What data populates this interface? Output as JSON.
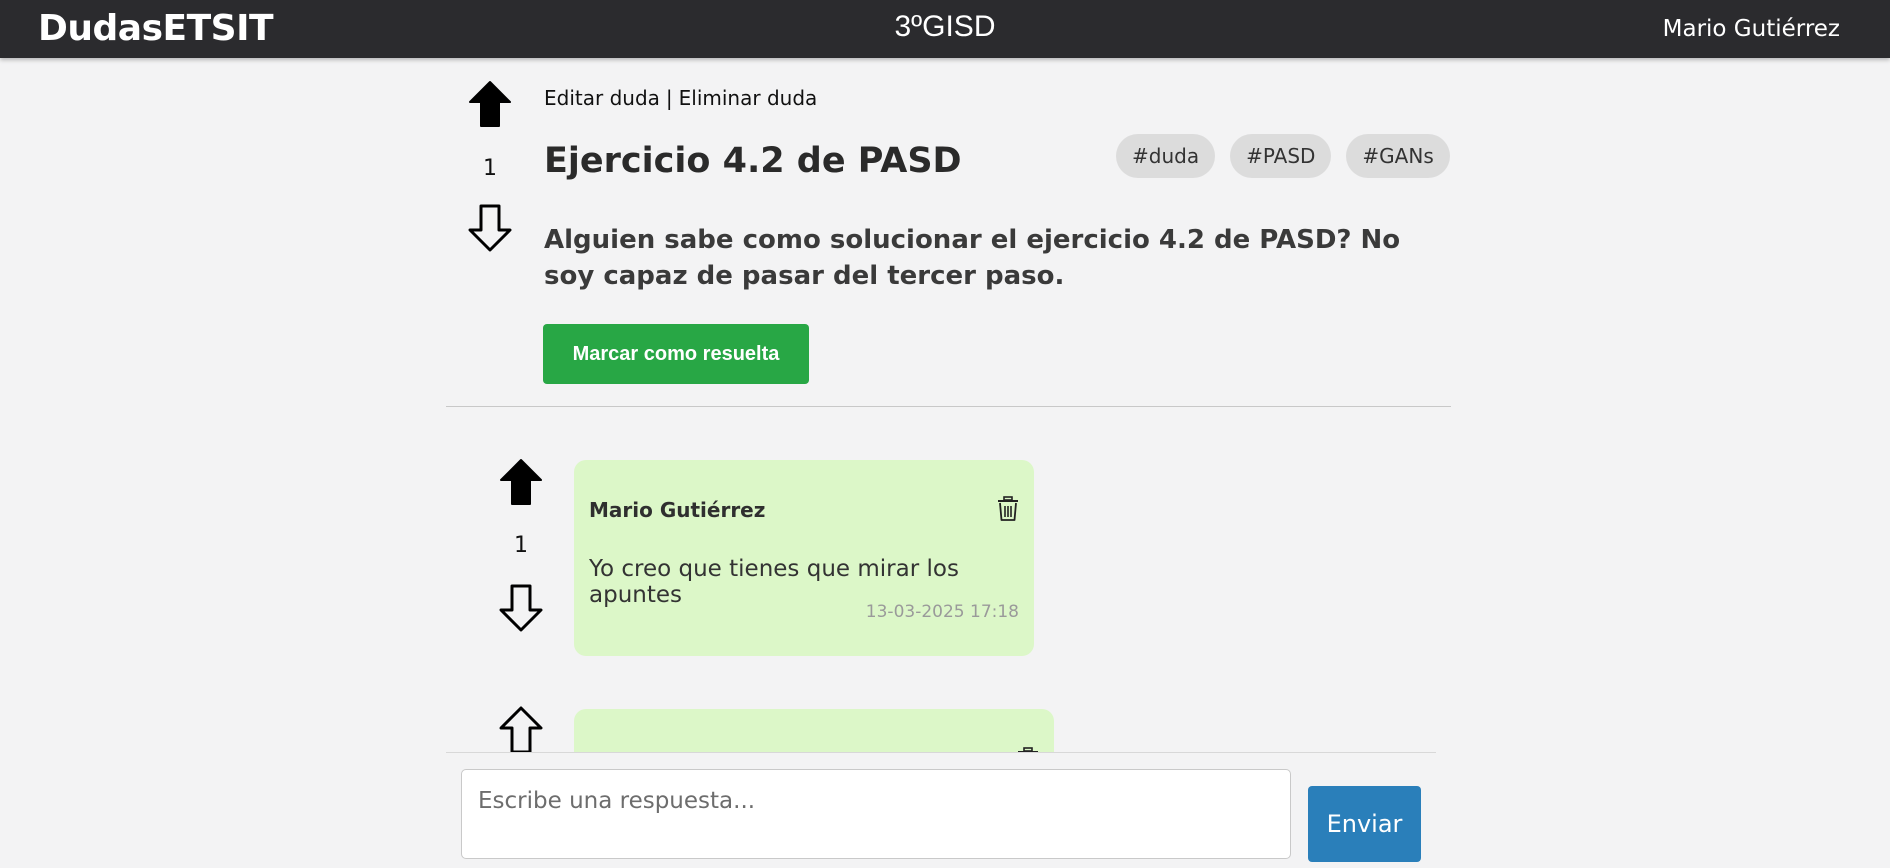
{
  "header": {
    "brand": "DudasETSIT",
    "course": "3ºGISD",
    "user_name": "Mario Gutiérrez"
  },
  "question": {
    "edit_label": "Editar duda",
    "separator": "|",
    "delete_label": "Eliminar duda",
    "title": "Ejercicio 4.2 de PASD",
    "tags": [
      "#duda",
      "#PASD",
      "#GANs"
    ],
    "body": "Alguien sabe como solucionar el ejercicio 4.2 de PASD? No soy capaz de pasar del tercer paso.",
    "votes": "1",
    "upvote_icon": "arrow-up-filled-icon",
    "downvote_icon": "arrow-down-outline-icon",
    "resolve_label": "Marcar como resuelta",
    "resolve_color": "#28a745"
  },
  "replies": [
    {
      "author": "Mario Gutiérrez",
      "text": "Yo creo que tienes que mirar los apuntes",
      "date": "13-03-2025 17:18",
      "votes": "1"
    }
  ],
  "compose": {
    "placeholder": "Escribe una respuesta...",
    "send_label": "Enviar",
    "send_color": "#2a7fba"
  },
  "colors": {
    "topbar": "#2b2b2e",
    "reply_bg": "#dcf7c8",
    "page_bg": "#f3f3f4"
  }
}
